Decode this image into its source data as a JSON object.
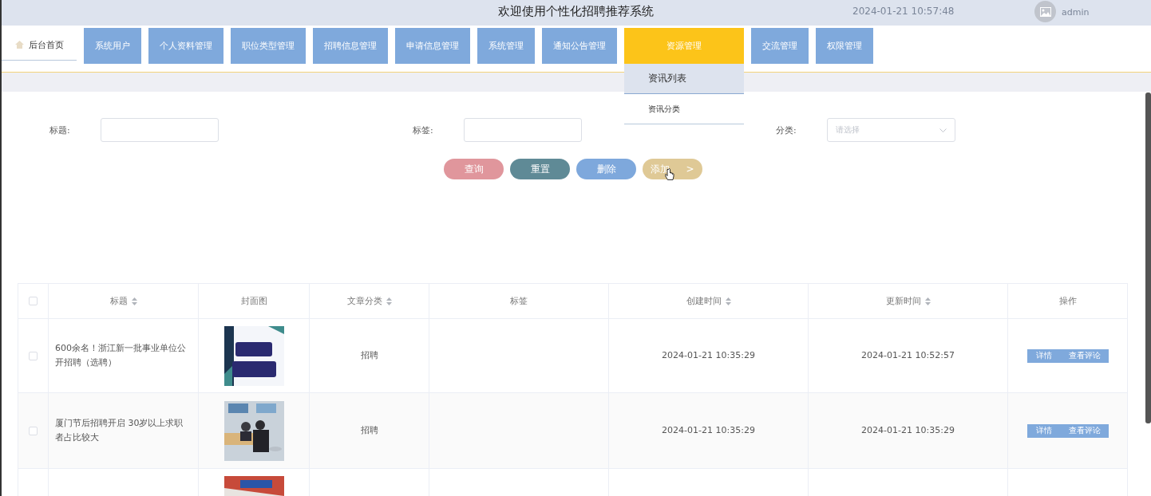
{
  "header": {
    "title": "欢迎使用个性化招聘推荐系统",
    "datetime": "2024-01-21 10:57:48",
    "user": "admin"
  },
  "nav": {
    "home": {
      "label": "后台首页",
      "selected": false
    },
    "items": [
      {
        "label": "系统用户",
        "selected": false
      },
      {
        "label": "个人资料管理",
        "selected": false
      },
      {
        "label": "职位类型管理",
        "selected": false
      },
      {
        "label": "招聘信息管理",
        "selected": false
      },
      {
        "label": "申请信息管理",
        "selected": false
      },
      {
        "label": "系统管理",
        "selected": false
      },
      {
        "label": "通知公告管理",
        "selected": false
      },
      {
        "label": "资源管理",
        "selected": true,
        "submenu": [
          {
            "label": "资讯列表",
            "selected": true
          },
          {
            "label": "资讯分类",
            "selected": false
          }
        ]
      },
      {
        "label": "交流管理",
        "selected": false
      },
      {
        "label": "权限管理",
        "selected": false
      }
    ]
  },
  "search": {
    "fields": [
      {
        "kind": "input",
        "label": "标题:"
      },
      {
        "kind": "input",
        "label": "标签:"
      },
      {
        "kind": "select",
        "label": "分类:",
        "placeholder": "请选择"
      }
    ],
    "buttons": [
      {
        "label": "查询",
        "color": "#e0969c"
      },
      {
        "label": "重置",
        "color": "#5f8a96"
      },
      {
        "label": "删除",
        "color": "#7ea8dc"
      },
      {
        "label": "添加",
        "suffix": ">",
        "color": "#dfc996"
      }
    ]
  },
  "table": {
    "all_checked": false,
    "columns": [
      {
        "label": "标题",
        "sortable": true
      },
      {
        "label": "封面图",
        "sortable": false
      },
      {
        "label": "文章分类",
        "sortable": true
      },
      {
        "label": "标签",
        "sortable": false
      },
      {
        "label": "创建时间",
        "sortable": true
      },
      {
        "label": "更新时间",
        "sortable": true
      },
      {
        "label": "操作",
        "sortable": false
      }
    ],
    "rows": [
      {
        "checked": false,
        "title": "600余名！浙江新一批事业单位公开招聘（选聘）",
        "cover": {
          "kind": "picture"
        },
        "category": "招聘",
        "created": "2024-01-21 10:35:29",
        "updated": "2024-01-21 10:52:57",
        "actions": [
          "详情",
          "查看评论"
        ]
      },
      {
        "checked": false,
        "title": "厦门节后招聘开启 30岁以上求职者占比较大",
        "cover": {
          "kind": "picture"
        },
        "category": "招聘",
        "created": "2024-01-21 10:35:29",
        "updated": "2024-01-21 10:35:29",
        "actions": [
          "详情",
          "查看评论"
        ]
      },
      {
        "cover": {
          "kind": "picture"
        }
      }
    ]
  }
}
